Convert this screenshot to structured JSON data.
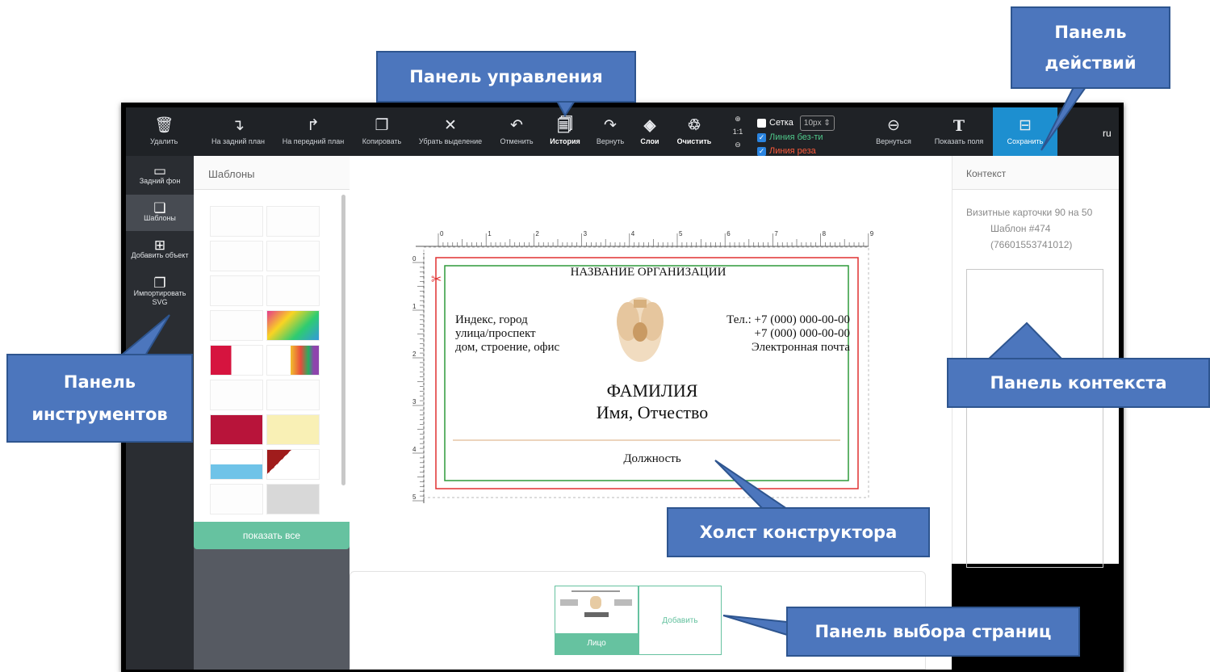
{
  "toolbar": {
    "buttons": [
      {
        "label": "Удалить",
        "icon": "🗑"
      },
      {
        "label": "На задний план",
        "icon": "↴"
      },
      {
        "label": "На передний план",
        "icon": "↱"
      },
      {
        "label": "Копировать",
        "icon": "❐"
      },
      {
        "label": "Убрать выделение",
        "icon": "✕"
      },
      {
        "label": "Отменить",
        "icon": "↶"
      },
      {
        "label": "История",
        "icon": "🗐"
      },
      {
        "label": "Вернуть",
        "icon": "↷"
      },
      {
        "label": "Слои",
        "icon": "◈"
      },
      {
        "label": "Очистить",
        "icon": "♲"
      }
    ],
    "zoom": {
      "in": "⊕",
      "ratio": "1:1",
      "out": "⊖"
    },
    "grid_label": "Сетка",
    "grid_value": "10px ⇕",
    "line_safe_label": "Линия без-ти",
    "line_cut_label": "Линия реза",
    "back_label": "Вернуться",
    "back_icon": "⊖",
    "show_fields_label": "Показать поля",
    "show_fields_icon": "T",
    "save_label": "Сохранить",
    "save_icon": "⊟",
    "lang": "ru"
  },
  "tools": [
    {
      "label": "Задний фон",
      "icon": "▭"
    },
    {
      "label": "Шаблоны",
      "icon": "❏"
    },
    {
      "label": "Добавить объект",
      "icon": "⊞"
    },
    {
      "label": "Импортировать SVG",
      "icon": "❐"
    }
  ],
  "templates": {
    "title": "Шаблоны",
    "show_all": "показать все"
  },
  "card": {
    "org": "НАЗВАНИЕ ОРГАНИЗАЦИИ",
    "addr1": "Индекс, город",
    "addr2": "улица/проспект",
    "addr3": "дом, строение, офис",
    "phone1": "Тел.: +7 (000) 000-00-00",
    "phone2": "+7 (000) 000-00-00",
    "email": "Электронная почта",
    "surname": "ФАМИЛИЯ",
    "name": "Имя, Отчество",
    "position": "Должность"
  },
  "ruler": {
    "h_ticks": [
      "0",
      "1",
      "2",
      "3",
      "4",
      "5",
      "6",
      "7",
      "8",
      "9"
    ],
    "v_ticks": [
      "0",
      "1",
      "2",
      "3",
      "4",
      "5"
    ]
  },
  "context": {
    "title": "Контекст",
    "product": "Визитные карточки 90 на 50",
    "template": "Шаблон #474",
    "template_id": "(76601553741012)"
  },
  "pages": {
    "front_label": "Лицо",
    "add_label": "Добавить"
  },
  "callouts": {
    "control": "Панель управления",
    "actions": "Панель действий",
    "tools": "Панель инструментов",
    "context": "Панель контекста",
    "canvas": "Холст конструктора",
    "pages": "Панель выбора страниц"
  },
  "colors": {
    "toolbar_bg": "#1f2226",
    "save_bg": "#1d8fd0",
    "accent_green": "#66c2a0",
    "callout_bg": "#4c76bd",
    "cut_line": "#e03030",
    "safe_line": "#2f9a3a"
  }
}
